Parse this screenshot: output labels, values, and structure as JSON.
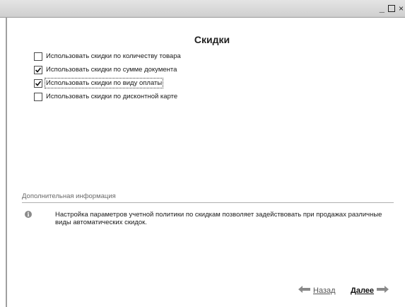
{
  "window": {
    "minimize_glyph": "_",
    "close_glyph": "×"
  },
  "page": {
    "title": "Скидки"
  },
  "options": [
    {
      "label": "Использовать скидки по количеству товара",
      "checked": false
    },
    {
      "label": "Использовать скидки по сумме документа",
      "checked": true
    },
    {
      "label": "Использовать скидки по виду оплаты",
      "checked": true
    },
    {
      "label": "Использовать скидки по дисконтной карте",
      "checked": false
    }
  ],
  "info": {
    "section_title": "Дополнительная информация",
    "icon": "info-icon",
    "text": "Настройка параметров учетной политики по скидкам позволяет задействовать при продажах различные виды автоматических скидок."
  },
  "nav": {
    "back_label": "Назад",
    "next_label": "Далее",
    "back_icon": "arrow-left-icon",
    "next_icon": "arrow-right-icon"
  }
}
